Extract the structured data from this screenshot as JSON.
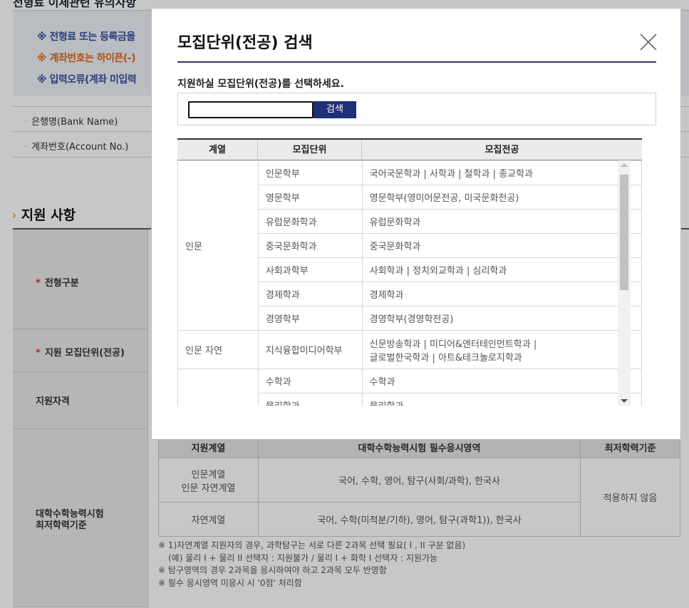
{
  "background": {
    "top_title": "전형료 이체관련 유의사항",
    "notices": [
      "※ 전형료 또는 등록금을",
      "※ 계좌번호는 하이픈(-)",
      "※ 입력오류(계좌 미입력"
    ],
    "fields": [
      "은행명(Bank Name)",
      "계좌번호(Account No.)"
    ],
    "section_title": "지원 사항",
    "section_marker": "›",
    "labels": [
      "전형구분",
      "지원 모집단위(전공)",
      "지원자격",
      "대학수학능력시험",
      "최저학력기준"
    ],
    "suneung_table": {
      "headers": [
        "지원계열",
        "대학수학능력시험 필수응시영역",
        "최저학력기준"
      ],
      "row1_group": "인문계열",
      "row1_group2": "인문 자연계열",
      "row1_subjects": "국어, 수학, 영어, 탐구(사회/과학), 한국사",
      "row2_group": "자연계열",
      "row2_subjects": "국어, 수학(미적분/기하), 영어, 탐구(과학1)), 한국사",
      "minimum": "적용하지 않음"
    },
    "notes": [
      "※ 1)자연계열 지원자의 경우, 과학탐구는 서로 다른 2과목 선택 필요( I , II 구분 없음)",
      "(예) 물리 I + 물리 II 선택자 : 지원불가 / 물리 I + 화학 I 선택자 : 지원가능",
      "※ 탐구영역의 경우 2과목을 응시하여야 하고 2과목 모두 반영함",
      "※ 필수 응시영역 미응시 시 '0점' 처리함"
    ]
  },
  "modal": {
    "title": "모집단위(전공) 검색",
    "subtitle": "지원하실 모집단위(전공)를 선택하세요.",
    "search_value": "",
    "search_button": "검색",
    "columns": [
      "계열",
      "모집단위",
      "모집전공"
    ],
    "groups": [
      "인문",
      "인문 자연"
    ],
    "rows": [
      {
        "unit": "인문학부",
        "major": "국어국문학과 | 사학과 | 철학과 | 종교학과"
      },
      {
        "unit": "영문학부",
        "major": "영문학부(영미어문전공, 미국문화전공)"
      },
      {
        "unit": "유럽문화학과",
        "major": "유럽문화학과"
      },
      {
        "unit": "중국문화학과",
        "major": "중국문화학과"
      },
      {
        "unit": "사회과학부",
        "major": "사회학과 | 정치외교학과 | 심리학과"
      },
      {
        "unit": "경제학과",
        "major": "경제학과"
      },
      {
        "unit": "경영학부",
        "major": "경영학부(경영학전공)"
      },
      {
        "unit": "지식융합미디어학부",
        "major": "신문방송학과 | 미디어&엔터테인먼트학과 |",
        "major2": "글로벌한국학과 | 아트&테크놀로지학과"
      },
      {
        "unit": "수학과",
        "major": "수학과"
      },
      {
        "unit": "물리학과",
        "major": "물리학과"
      }
    ]
  }
}
